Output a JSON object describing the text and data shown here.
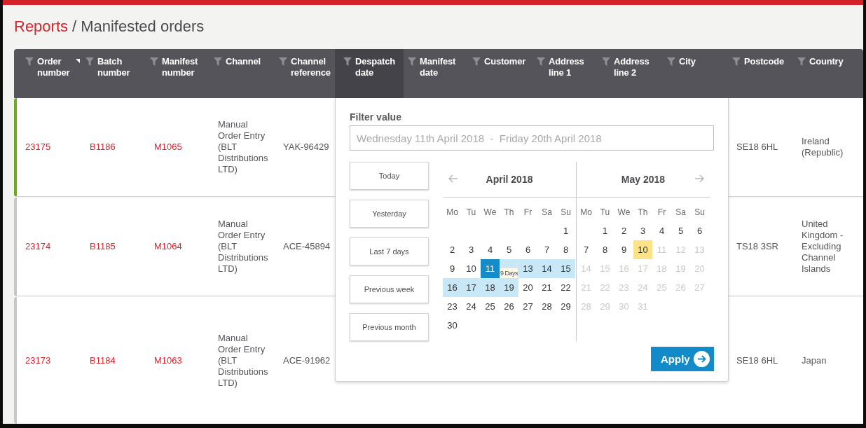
{
  "breadcrumb": {
    "parent": "Reports",
    "separator": "/",
    "title": "Manifested orders"
  },
  "table": {
    "columns": [
      {
        "label": "Order number",
        "sorted": true,
        "filter_open": false
      },
      {
        "label": "Batch number",
        "sorted": false,
        "filter_open": false
      },
      {
        "label": "Manifest number",
        "sorted": false,
        "filter_open": false
      },
      {
        "label": "Channel",
        "sorted": false,
        "filter_open": false
      },
      {
        "label": "Channel reference",
        "sorted": false,
        "filter_open": false
      },
      {
        "label": "Despatch date",
        "sorted": false,
        "filter_open": true
      },
      {
        "label": "Manifest date",
        "sorted": false,
        "filter_open": false
      },
      {
        "label": "Customer",
        "sorted": false,
        "filter_open": false
      },
      {
        "label": "Address line 1",
        "sorted": false,
        "filter_open": false
      },
      {
        "label": "Address line 2",
        "sorted": false,
        "filter_open": false
      },
      {
        "label": "City",
        "sorted": false,
        "filter_open": false
      },
      {
        "label": "Postcode",
        "sorted": false,
        "filter_open": false
      },
      {
        "label": "Country",
        "sorted": false,
        "filter_open": false
      }
    ],
    "rows": [
      {
        "color": "#6aaa1e",
        "order_number": "23175",
        "batch_number": "B1186",
        "manifest_number": "M1065",
        "channel": "Manual Order Entry (BLT Distributions LTD)",
        "channel_reference": "YAK-96429",
        "postcode": "SE18 6HL",
        "country": "Ireland (Republic)"
      },
      {
        "color": "#c4c6c8",
        "order_number": "23174",
        "batch_number": "B1185",
        "manifest_number": "M1064",
        "channel": "Manual Order Entry (BLT Distributions LTD)",
        "channel_reference": "ACE-45894",
        "postcode": "TS18 3SR",
        "country": "United Kingdom - Excluding Channel Islands"
      },
      {
        "color": "#c4c6c8",
        "order_number": "23173",
        "batch_number": "B1184",
        "manifest_number": "M1063",
        "channel": "Manual Order Entry (BLT Distributions LTD)",
        "channel_reference": "ACE-91962",
        "postcode": "SE18 6HL",
        "country": "Japan"
      }
    ]
  },
  "filter_popover": {
    "label": "Filter value",
    "value": "Wednesday 11th April 2018  -  Friday 20th April 2018",
    "presets": [
      "Today",
      "Yesterday",
      "Last 7 days",
      "Previous week",
      "Previous month"
    ],
    "months": [
      {
        "title": "April 2018",
        "prev_arrow": true,
        "next_arrow": false,
        "weekdays": [
          "Mo",
          "Tu",
          "We",
          "Th",
          "Fr",
          "Sa",
          "Su"
        ],
        "weeks": [
          [
            {
              "day": "1",
              "kind": "day"
            }
          ],
          [
            {
              "day": "2",
              "kind": "day"
            },
            {
              "day": "3",
              "kind": "day"
            },
            {
              "day": "4",
              "kind": "day"
            },
            {
              "day": "5",
              "kind": "day"
            },
            {
              "day": "6",
              "kind": "day"
            },
            {
              "day": "7",
              "kind": "day"
            },
            {
              "day": "8",
              "kind": "day"
            }
          ],
          [
            {
              "day": "9",
              "kind": "day"
            },
            {
              "day": "10",
              "kind": "day"
            },
            {
              "day": "11",
              "kind": "start"
            },
            {
              "kind": "range"
            },
            {
              "day": "13",
              "kind": "range"
            },
            {
              "day": "14",
              "kind": "range"
            },
            {
              "day": "15",
              "kind": "range"
            }
          ],
          [
            {
              "day": "16",
              "kind": "range"
            },
            {
              "day": "17",
              "kind": "range"
            },
            {
              "day": "18",
              "kind": "range"
            },
            {
              "day": "19",
              "kind": "range"
            },
            {
              "day": "20",
              "kind": "day"
            },
            {
              "day": "21",
              "kind": "day"
            },
            {
              "day": "22",
              "kind": "day"
            }
          ],
          [
            {
              "day": "23",
              "kind": "day"
            },
            {
              "day": "24",
              "kind": "day"
            },
            {
              "day": "25",
              "kind": "day"
            },
            {
              "day": "26",
              "kind": "day"
            },
            {
              "day": "27",
              "kind": "day"
            },
            {
              "day": "28",
              "kind": "day"
            },
            {
              "day": "29",
              "kind": "day"
            }
          ],
          [
            {
              "day": "30",
              "kind": "day"
            }
          ]
        ]
      },
      {
        "title": "May 2018",
        "prev_arrow": false,
        "next_arrow": true,
        "weekdays": [
          "Mo",
          "Tu",
          "We",
          "Th",
          "Fr",
          "Sa",
          "Su"
        ],
        "weeks": [
          [
            {
              "day": "1",
              "kind": "day"
            },
            {
              "day": "2",
              "kind": "day"
            },
            {
              "day": "3",
              "kind": "day"
            },
            {
              "day": "4",
              "kind": "day"
            },
            {
              "day": "5",
              "kind": "day"
            },
            {
              "day": "6",
              "kind": "day"
            }
          ],
          [
            {
              "day": "7",
              "kind": "day"
            },
            {
              "day": "8",
              "kind": "day"
            },
            {
              "day": "9",
              "kind": "day"
            },
            {
              "day": "10",
              "kind": "today"
            },
            {
              "day": "11",
              "kind": "muted"
            },
            {
              "day": "12",
              "kind": "muted"
            },
            {
              "day": "13",
              "kind": "muted"
            }
          ],
          [
            {
              "day": "14",
              "kind": "muted"
            },
            {
              "day": "15",
              "kind": "muted"
            },
            {
              "day": "16",
              "kind": "muted"
            },
            {
              "day": "17",
              "kind": "muted"
            },
            {
              "day": "18",
              "kind": "muted"
            },
            {
              "day": "19",
              "kind": "muted"
            },
            {
              "day": "20",
              "kind": "muted"
            }
          ],
          [
            {
              "day": "21",
              "kind": "muted"
            },
            {
              "day": "22",
              "kind": "muted"
            },
            {
              "day": "23",
              "kind": "muted"
            },
            {
              "day": "24",
              "kind": "muted"
            },
            {
              "day": "25",
              "kind": "muted"
            },
            {
              "day": "26",
              "kind": "muted"
            },
            {
              "day": "27",
              "kind": "muted"
            }
          ],
          [
            {
              "day": "28",
              "kind": "muted"
            },
            {
              "day": "29",
              "kind": "muted"
            },
            {
              "day": "30",
              "kind": "muted"
            },
            {
              "day": "31",
              "kind": "muted"
            }
          ]
        ]
      }
    ],
    "range_tooltip": "9 Days",
    "apply": "Apply"
  }
}
